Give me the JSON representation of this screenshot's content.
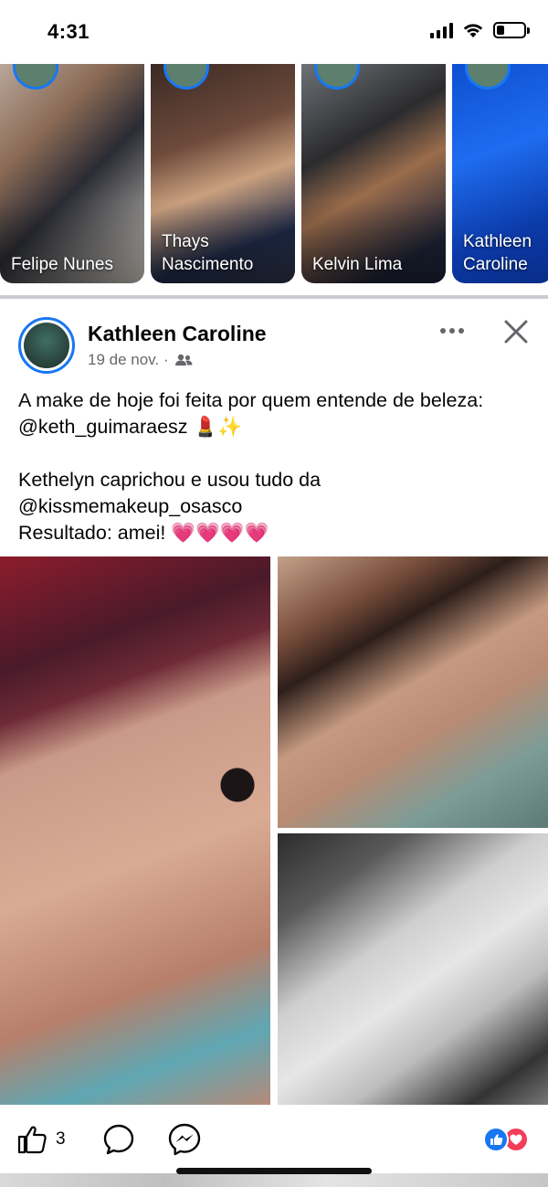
{
  "status_bar": {
    "time": "4:31"
  },
  "stories": [
    {
      "name": "Felipe Nunes"
    },
    {
      "name": "Thays Nascimento"
    },
    {
      "name": "Kelvin Lima"
    },
    {
      "name": "Kathleen Caroline"
    }
  ],
  "post": {
    "author": "Kathleen Caroline",
    "date": "19 de nov. ·",
    "audience_icon": "friends-icon",
    "text": "A make de hoje foi feita por quem entende de beleza: @keth_guimaraesz 💄✨\n\nKethelyn caprichou e usou tudo da @kissmemakeup_osasco\nResultado: amei! 💗💗💗💗",
    "photos": [
      {
        "name": "photo-left"
      },
      {
        "name": "photo-right-top"
      },
      {
        "name": "photo-right-bottom"
      }
    ],
    "actions": {
      "like_count": "3",
      "reactions": [
        "like",
        "love"
      ]
    }
  },
  "colors": {
    "accent": "#1877f2",
    "secondary_text": "#65676b",
    "love": "#f33e58",
    "divider": "#c9ccd1"
  }
}
